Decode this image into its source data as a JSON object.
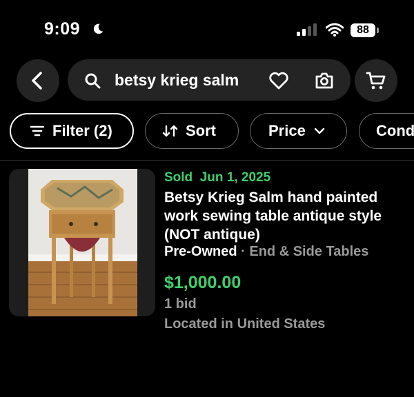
{
  "status_bar": {
    "time": "9:09",
    "battery": "88"
  },
  "search": {
    "query": "betsy krieg salm"
  },
  "filters": [
    {
      "label": "Filter (2)"
    },
    {
      "label": "Sort"
    },
    {
      "label": "Price"
    },
    {
      "label": "Cond"
    }
  ],
  "listing": {
    "sold_label": "Sold",
    "sold_date": "Jun 1, 2025",
    "title": "Betsy Krieg Salm hand painted work sewing table antique style (NOT antique)",
    "condition": "Pre-Owned",
    "separator": "·",
    "category": "End & Side Tables",
    "price": "$1,000.00",
    "bids": "1 bid",
    "location": "Located in United States"
  },
  "colors": {
    "sold_green": "#3ecf6b",
    "chip_bg": "#242424",
    "muted": "#9a9a9a"
  },
  "icons": [
    "moon-icon",
    "signal-icon",
    "wifi-icon",
    "back-arrow-icon",
    "search-icon",
    "heart-icon",
    "camera-icon",
    "cart-icon",
    "filter-icon",
    "sort-icon",
    "chevron-down-icon"
  ]
}
